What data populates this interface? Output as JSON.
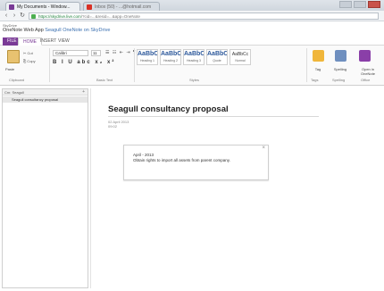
{
  "browser": {
    "tabs": [
      {
        "label": "My Documents - Window..."
      },
      {
        "label": "Inbox (50) - ...@hotmail.com"
      }
    ],
    "url_host": "https://skydrive.live.com",
    "url_path": "/?cid=...&resid=...&app=OneNote"
  },
  "app": {
    "brand": "SkyDrive",
    "name": "OneNote Web App",
    "breadcrumb": "Seagull",
    "location_link": "OneNote on SkyDrive",
    "notebook_label": "Seagull"
  },
  "ribbon": {
    "tabs": {
      "file": "FILE",
      "home": "HOME",
      "insert": "INSERT",
      "view": "VIEW"
    },
    "paste_label": "Paste",
    "cut_label": "✂ Cut",
    "copy_label": "⎘ Copy",
    "font_name": "Calibri",
    "font_size": "11",
    "format_glyphs": "B I U abc x₂ x²",
    "list_glyphs": "☰ ☷ ⇤ ⇥ ¶",
    "group_labels": {
      "clipboard": "Clipboard",
      "basic_text": "Basic Text",
      "styles": "Styles",
      "tags": "Tags",
      "spelling": "Spelling",
      "office": "Office"
    },
    "styles": [
      {
        "sample": "AaBbCc",
        "name": "Heading 1"
      },
      {
        "sample": "AaBbCc",
        "name": "Heading 2"
      },
      {
        "sample": "AaBbCc",
        "name": "Heading 3"
      },
      {
        "sample": "AaBbCc",
        "name": "Quote"
      },
      {
        "sample": "AaBbCc",
        "name": "Normal"
      }
    ],
    "tag_label": "Tag",
    "spelling_label": "Spelling",
    "open_onenote_label": "Open in OneNote",
    "colors": {
      "accent": "#7a3a96"
    }
  },
  "sections": {
    "header": "Cnr. Seagull",
    "add_glyph": "+",
    "pages": [
      "Seagull consultancy proposal"
    ]
  },
  "page": {
    "title": "Seagull consultancy proposal",
    "date": "02 April 2013",
    "time": "09:02",
    "note": {
      "line1": "April - 2013",
      "line2": "Obtain rights to import all assets from parent company."
    }
  }
}
